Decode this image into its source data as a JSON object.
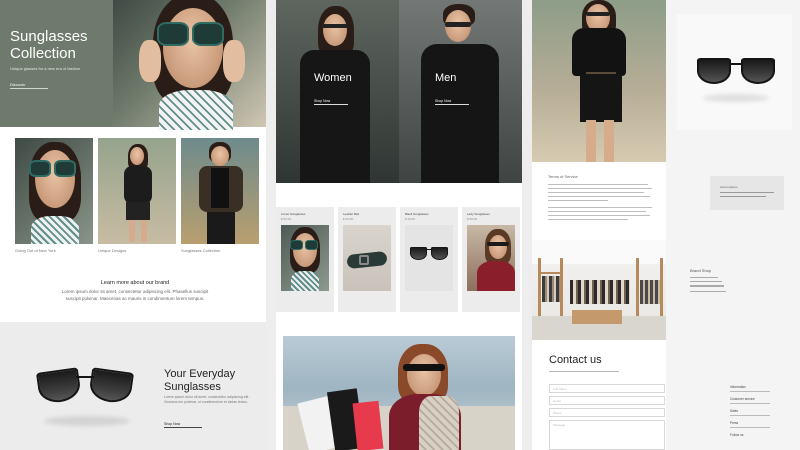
{
  "page1": {
    "hero": {
      "title_line1": "Sunglasses",
      "title_line2": "Collection",
      "subtitle": "Unique glasses for a new era of fashion",
      "cta": "Discover"
    },
    "gallery": [
      {
        "caption": "Going Out of New York"
      },
      {
        "caption": "Unique Designs"
      },
      {
        "caption": "Sunglasses Collection"
      }
    ],
    "brand": {
      "heading": "Learn more about our brand",
      "body": "Lorem ipsum dolor sit amet, consectetur adipiscing elit. Phasellus suscipit suscipit pulvinar. Maecenas ac mauris in condimentum lorem tempus."
    },
    "everyday": {
      "title_line1": "Your Everyday",
      "title_line2": "Sunglasses",
      "body": "Lorem ipsum dolor sit amet, consectetur adipiscing elit. Vivamus leo pulvinar, ut condimentum et dictas lectus.",
      "cta": "Shop Now"
    }
  },
  "page2": {
    "women": {
      "label": "Women",
      "cta": "Shop Now"
    },
    "men": {
      "label": "Men",
      "cta": "Shop Now"
    },
    "products": [
      {
        "name": "Linnet Sunglasses",
        "price": "$ 52.00"
      },
      {
        "name": "Leather Belt",
        "price": "$ 25.00"
      },
      {
        "name": "Black Sunglasses",
        "price": "$ 44.00"
      },
      {
        "name": "Lady Sunglasses",
        "price": "$ 59.00"
      }
    ]
  },
  "page3": {
    "terms": {
      "title": "Terms of Service"
    },
    "side_note": {
      "text": "Lorem ipsum"
    },
    "brand_shop": {
      "title": "Brand Shop"
    },
    "contact": {
      "title": "Contact us",
      "fields": [
        "Full Name",
        "Email",
        "Phone",
        "Message"
      ]
    },
    "info": [
      {
        "heading": "Information"
      },
      {
        "heading": "Customer service"
      },
      {
        "heading": "Sales"
      },
      {
        "heading": "Press"
      },
      {
        "heading": "Follow us"
      }
    ]
  }
}
